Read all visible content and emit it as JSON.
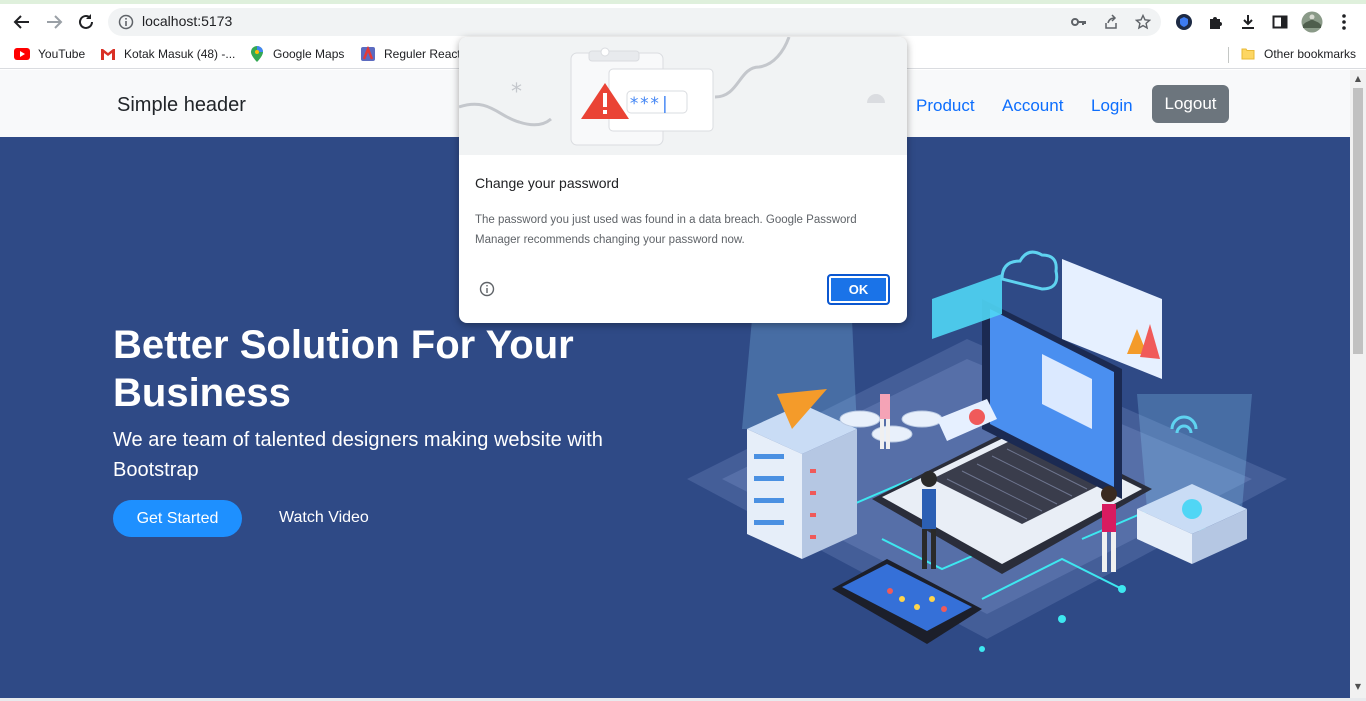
{
  "browser": {
    "url": "localhost:5173",
    "bookmarks": [
      {
        "label": "YouTube",
        "icon": "youtube-icon"
      },
      {
        "label": "Kotak Masuk (48) -...",
        "icon": "gmail-icon"
      },
      {
        "label": "Google Maps",
        "icon": "maps-icon"
      },
      {
        "label": "Reguler React",
        "icon": "bookmark-favicon-icon"
      }
    ],
    "other_bookmarks": "Other bookmarks"
  },
  "header": {
    "brand": "Simple header",
    "nav": [
      "Product",
      "Account",
      "Login"
    ],
    "logout": "Logout"
  },
  "hero": {
    "title": "Better Solution For Your Business",
    "subtitle": "We are team of talented designers making website with Bootstrap",
    "primary_button": "Get Started",
    "secondary_button": "Watch Video",
    "background": "#2f4a86"
  },
  "dialog": {
    "password_mask": "***|",
    "title": "Change your password",
    "body": "The password you just used was found in a data breach. Google Password Manager recommends changing your password now.",
    "ok": "OK"
  },
  "colors": {
    "accent": "#1a73e8",
    "link": "#0d6efd",
    "logout_bg": "#6c757d",
    "get_started": "#1e90ff"
  }
}
